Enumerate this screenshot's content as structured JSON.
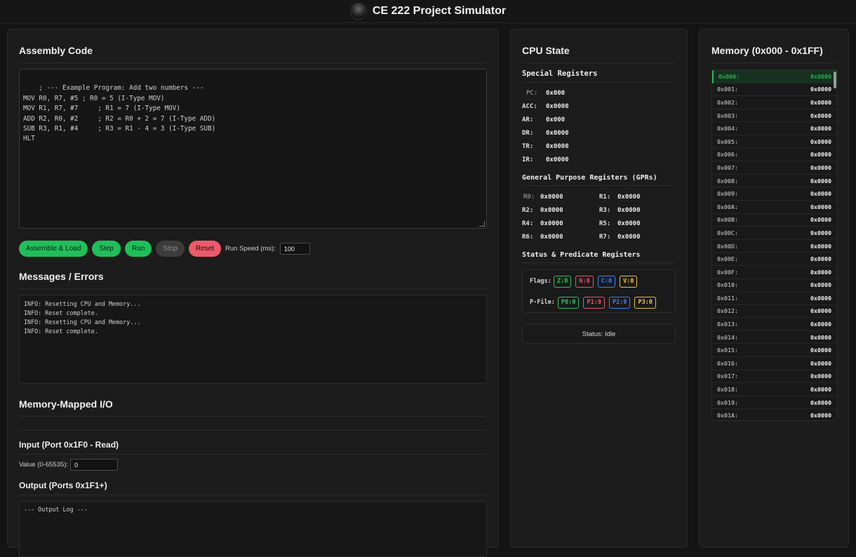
{
  "header": {
    "title": "CE 222 Project Simulator"
  },
  "assembly": {
    "title": "Assembly Code",
    "code": "; --- Example Program: Add two numbers ---\nMOV R0, R7, #5 ; R0 = 5 (I-Type MOV)\nMOV R1, R7, #7     ; R1 = 7 (I-Type MOV)\nADD R2, R0, #2     ; R2 = R0 + 2 = 7 (I-Type ADD)\nSUB R3, R1, #4     ; R3 = R1 - 4 = 3 (I-Type SUB)\nHLT"
  },
  "controls": {
    "assemble_label": "Assemble & Load",
    "step_label": "Step",
    "run_label": "Run",
    "stop_label": "Stop",
    "reset_label": "Reset",
    "speed_label": "Run Speed (ms):",
    "speed_value": "100"
  },
  "messages": {
    "title": "Messages / Errors",
    "log": "INFO: Resetting CPU and Memory...\nINFO: Reset complete.\nINFO: Resetting CPU and Memory...\nINFO: Reset complete."
  },
  "io": {
    "title": "Memory-Mapped I/O",
    "input_title": "Input (Port 0x1F0 - Read)",
    "value_label": "Value (0-65535):",
    "value": "0",
    "output_title": "Output (Ports 0x1F1+)",
    "output_log": "--- Output Log ---"
  },
  "cpu": {
    "title": "CPU State",
    "special_title": "Special Registers",
    "special": [
      {
        "name": "PC:",
        "value": "0x000"
      },
      {
        "name": "ACC:",
        "value": "0x0000"
      },
      {
        "name": "AR:",
        "value": "0x000"
      },
      {
        "name": "DR:",
        "value": "0x0000"
      },
      {
        "name": "TR:",
        "value": "0x0000"
      },
      {
        "name": "IR:",
        "value": "0x0000"
      }
    ],
    "gpr_title": "General Purpose Registers (GPRs)",
    "gpr": [
      {
        "name": "R0:",
        "value": "0x0000"
      },
      {
        "name": "R1:",
        "value": "0x0000"
      },
      {
        "name": "R2:",
        "value": "0x0000"
      },
      {
        "name": "R3:",
        "value": "0x0000"
      },
      {
        "name": "R4:",
        "value": "0x0000"
      },
      {
        "name": "R5:",
        "value": "0x0000"
      },
      {
        "name": "R6:",
        "value": "0x0000"
      },
      {
        "name": "R7:",
        "value": "0x0000"
      }
    ],
    "status_title": "Status & Predicate Registers",
    "flags_label": "Flags:",
    "flags": [
      {
        "label": "Z:0",
        "color": "#2fbf5f"
      },
      {
        "label": "N:0",
        "color": "#e0566a"
      },
      {
        "label": "C:0",
        "color": "#3b82f6"
      },
      {
        "label": "V:0",
        "color": "#e8c14a"
      }
    ],
    "pfile_label": "P-File:",
    "pfile": [
      {
        "label": "P0:0",
        "color": "#2fbf5f"
      },
      {
        "label": "P1:0",
        "color": "#e0566a"
      },
      {
        "label": "P2:0",
        "color": "#3b82f6"
      },
      {
        "label": "P3:0",
        "color": "#e8c14a"
      }
    ],
    "status": "Status: Idle"
  },
  "memory": {
    "title": "Memory (0x000 - 0x1FF)",
    "rows": [
      {
        "addr": "0x000:",
        "value": "0x0000"
      },
      {
        "addr": "0x001:",
        "value": "0x0000"
      },
      {
        "addr": "0x002:",
        "value": "0x0000"
      },
      {
        "addr": "0x003:",
        "value": "0x0000"
      },
      {
        "addr": "0x004:",
        "value": "0x0000"
      },
      {
        "addr": "0x005:",
        "value": "0x0000"
      },
      {
        "addr": "0x006:",
        "value": "0x0000"
      },
      {
        "addr": "0x007:",
        "value": "0x0000"
      },
      {
        "addr": "0x008:",
        "value": "0x0000"
      },
      {
        "addr": "0x009:",
        "value": "0x0000"
      },
      {
        "addr": "0x00A:",
        "value": "0x0000"
      },
      {
        "addr": "0x00B:",
        "value": "0x0000"
      },
      {
        "addr": "0x00C:",
        "value": "0x0000"
      },
      {
        "addr": "0x00D:",
        "value": "0x0000"
      },
      {
        "addr": "0x00E:",
        "value": "0x0000"
      },
      {
        "addr": "0x00F:",
        "value": "0x0000"
      },
      {
        "addr": "0x010:",
        "value": "0x0000"
      },
      {
        "addr": "0x011:",
        "value": "0x0000"
      },
      {
        "addr": "0x012:",
        "value": "0x0000"
      },
      {
        "addr": "0x013:",
        "value": "0x0000"
      },
      {
        "addr": "0x014:",
        "value": "0x0000"
      },
      {
        "addr": "0x015:",
        "value": "0x0000"
      },
      {
        "addr": "0x016:",
        "value": "0x0000"
      },
      {
        "addr": "0x017:",
        "value": "0x0000"
      },
      {
        "addr": "0x018:",
        "value": "0x0000"
      },
      {
        "addr": "0x019:",
        "value": "0x0000"
      },
      {
        "addr": "0x01A:",
        "value": "0x0000"
      }
    ]
  }
}
